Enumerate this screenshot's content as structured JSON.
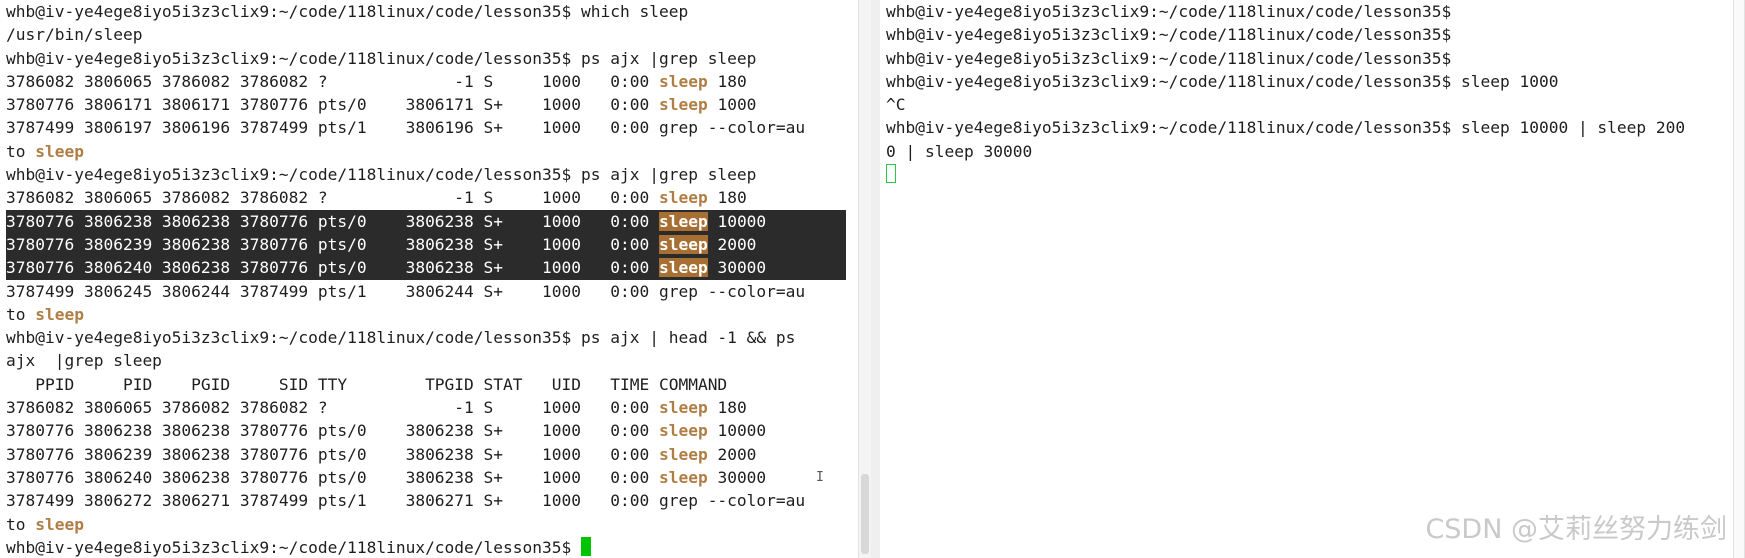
{
  "watermark": "CSDN @艾莉丝努力练剑",
  "mouse_cursor": "I",
  "colors": {
    "match_highlight": "#b07e44",
    "selection_bg": "#2b2b2b",
    "cursor": "#00c400"
  },
  "left_terminal": {
    "lines": [
      {
        "segs": [
          "whb@iv-ye4ege8iyo5i3z3clix9:~/code/118linux/code/lesson35$ which sleep"
        ]
      },
      {
        "segs": [
          "/usr/bin/sleep"
        ]
      },
      {
        "segs": [
          "whb@iv-ye4ege8iyo5i3z3clix9:~/code/118linux/code/lesson35$ ps ajx |grep sleep"
        ]
      },
      {
        "segs": [
          "3786082 3806065 3786082 3786082 ?             -1 S     1000   0:00 ",
          "sleep",
          " 180"
        ]
      },
      {
        "segs": [
          "3780776 3806171 3806171 3780776 pts/0    3806171 S+    1000   0:00 ",
          "sleep",
          " 1000"
        ]
      },
      {
        "segs": [
          "3787499 3806197 3806196 3787499 pts/1    3806196 S+    1000   0:00 grep --color=au"
        ]
      },
      {
        "segs": [
          "to ",
          "sleep"
        ]
      },
      {
        "segs": [
          "whb@iv-ye4ege8iyo5i3z3clix9:~/code/118linux/code/lesson35$ ps ajx |grep sleep"
        ]
      },
      {
        "segs": [
          "3786082 3806065 3786082 3786082 ?             -1 S     1000   0:00 ",
          "sleep",
          " 180"
        ]
      },
      {
        "segs": [
          "3780776 3806238 3806238 3780776 pts/0    3806238 S+    1000   0:00 ",
          "sleep",
          " 10000"
        ],
        "selected": true
      },
      {
        "segs": [
          "3780776 3806239 3806238 3780776 pts/0    3806238 S+    1000   0:00 ",
          "sleep",
          " 2000"
        ],
        "selected": true
      },
      {
        "segs": [
          "3780776 3806240 3806238 3780776 pts/0    3806238 S+    1000   0:00 ",
          "sleep",
          " 30000"
        ],
        "selected": true
      },
      {
        "segs": [
          "3787499 3806245 3806244 3787499 pts/1    3806244 S+    1000   0:00 grep --color=au"
        ]
      },
      {
        "segs": [
          "to ",
          "sleep"
        ]
      },
      {
        "segs": [
          "whb@iv-ye4ege8iyo5i3z3clix9:~/code/118linux/code/lesson35$ ps ajx | head -1 && ps"
        ]
      },
      {
        "segs": [
          "ajx  |grep sleep"
        ]
      },
      {
        "segs": [
          "   PPID     PID    PGID     SID TTY        TPGID STAT   UID   TIME COMMAND"
        ]
      },
      {
        "segs": [
          "3786082 3806065 3786082 3786082 ?             -1 S     1000   0:00 ",
          "sleep",
          " 180"
        ]
      },
      {
        "segs": [
          "3780776 3806238 3806238 3780776 pts/0    3806238 S+    1000   0:00 ",
          "sleep",
          " 10000"
        ]
      },
      {
        "segs": [
          "3780776 3806239 3806238 3780776 pts/0    3806238 S+    1000   0:00 ",
          "sleep",
          " 2000"
        ]
      },
      {
        "segs": [
          "3780776 3806240 3806238 3780776 pts/0    3806238 S+    1000   0:00 ",
          "sleep",
          " 30000"
        ]
      },
      {
        "segs": [
          "3787499 3806272 3806271 3787499 pts/1    3806271 S+    1000   0:00 grep --color=au"
        ]
      },
      {
        "segs": [
          "to ",
          "sleep"
        ]
      },
      {
        "segs": [
          "whb@iv-ye4ege8iyo5i3z3clix9:~/code/118linux/code/lesson35$ "
        ],
        "cursor": "solid"
      }
    ]
  },
  "right_terminal": {
    "lines": [
      {
        "segs": [
          "whb@iv-ye4ege8iyo5i3z3clix9:~/code/118linux/code/lesson35$"
        ]
      },
      {
        "segs": [
          "whb@iv-ye4ege8iyo5i3z3clix9:~/code/118linux/code/lesson35$"
        ]
      },
      {
        "segs": [
          "whb@iv-ye4ege8iyo5i3z3clix9:~/code/118linux/code/lesson35$"
        ]
      },
      {
        "segs": [
          "whb@iv-ye4ege8iyo5i3z3clix9:~/code/118linux/code/lesson35$ sleep 1000"
        ]
      },
      {
        "segs": [
          "^C"
        ]
      },
      {
        "segs": [
          "whb@iv-ye4ege8iyo5i3z3clix9:~/code/118linux/code/lesson35$ sleep 10000 | sleep 200"
        ]
      },
      {
        "segs": [
          "0 | sleep 30000"
        ]
      },
      {
        "segs": [
          ""
        ],
        "cursor": "hollow"
      }
    ]
  }
}
